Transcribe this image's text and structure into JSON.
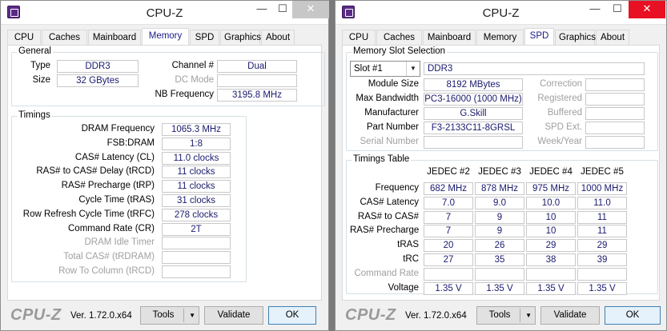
{
  "left": {
    "title": "CPU-Z",
    "controls": {
      "min": "—",
      "max": "☐",
      "close": "✕"
    },
    "tabs": [
      "CPU",
      "Caches",
      "Mainboard",
      "Memory",
      "SPD",
      "Graphics",
      "About"
    ],
    "active_tab": "Memory",
    "general": {
      "title": "General",
      "type_label": "Type",
      "type_value": "DDR3",
      "size_label": "Size",
      "size_value": "32 GBytes",
      "channel_label": "Channel #",
      "channel_value": "Dual",
      "dcmode_label": "DC Mode",
      "dcmode_value": "",
      "nbfreq_label": "NB Frequency",
      "nbfreq_value": "3195.8 MHz"
    },
    "timings": {
      "title": "Timings",
      "rows": [
        {
          "label": "DRAM Frequency",
          "value": "1065.3 MHz",
          "dim": false
        },
        {
          "label": "FSB:DRAM",
          "value": "1:8",
          "dim": false
        },
        {
          "label": "CAS# Latency (CL)",
          "value": "11.0 clocks",
          "dim": false
        },
        {
          "label": "RAS# to CAS# Delay (tRCD)",
          "value": "11 clocks",
          "dim": false
        },
        {
          "label": "RAS# Precharge (tRP)",
          "value": "11 clocks",
          "dim": false
        },
        {
          "label": "Cycle Time (tRAS)",
          "value": "31 clocks",
          "dim": false
        },
        {
          "label": "Row Refresh Cycle Time (tRFC)",
          "value": "278 clocks",
          "dim": false
        },
        {
          "label": "Command Rate (CR)",
          "value": "2T",
          "dim": false
        },
        {
          "label": "DRAM Idle Timer",
          "value": "",
          "dim": true
        },
        {
          "label": "Total CAS# (tRDRAM)",
          "value": "",
          "dim": true
        },
        {
          "label": "Row To Column (tRCD)",
          "value": "",
          "dim": true
        }
      ]
    },
    "footer": {
      "logo": "CPU-Z",
      "version": "Ver. 1.72.0.x64",
      "tools": "Tools",
      "validate": "Validate",
      "ok": "OK"
    }
  },
  "right": {
    "title": "CPU-Z",
    "controls": {
      "min": "—",
      "max": "☐",
      "close": "✕"
    },
    "tabs": [
      "CPU",
      "Caches",
      "Mainboard",
      "Memory",
      "SPD",
      "Graphics",
      "About"
    ],
    "active_tab": "SPD",
    "slot": {
      "title": "Memory Slot Selection",
      "selected": "Slot #1",
      "type_value": "DDR3",
      "module_size_label": "Module Size",
      "module_size_value": "8192 MBytes",
      "max_bw_label": "Max Bandwidth",
      "max_bw_value": "PC3-16000 (1000 MHz)",
      "manufacturer_label": "Manufacturer",
      "manufacturer_value": "G.Skill",
      "part_label": "Part Number",
      "part_value": "F3-2133C11-8GRSL",
      "serial_label": "Serial Number",
      "serial_value": "",
      "correction_label": "Correction",
      "correction_value": "",
      "registered_label": "Registered",
      "registered_value": "",
      "buffered_label": "Buffered",
      "buffered_value": "",
      "spdext_label": "SPD Ext.",
      "spdext_value": "",
      "weekyear_label": "Week/Year",
      "weekyear_value": ""
    },
    "timings_table": {
      "title": "Timings Table",
      "headers": [
        "JEDEC #2",
        "JEDEC #3",
        "JEDEC #4",
        "JEDEC #5"
      ],
      "rows": [
        {
          "label": "Frequency",
          "values": [
            "682 MHz",
            "878 MHz",
            "975 MHz",
            "1000 MHz"
          ],
          "dim": false
        },
        {
          "label": "CAS# Latency",
          "values": [
            "7.0",
            "9.0",
            "10.0",
            "11.0"
          ],
          "dim": false
        },
        {
          "label": "RAS# to CAS#",
          "values": [
            "7",
            "9",
            "10",
            "11"
          ],
          "dim": false
        },
        {
          "label": "RAS# Precharge",
          "values": [
            "7",
            "9",
            "10",
            "11"
          ],
          "dim": false
        },
        {
          "label": "tRAS",
          "values": [
            "20",
            "26",
            "29",
            "29"
          ],
          "dim": false
        },
        {
          "label": "tRC",
          "values": [
            "27",
            "35",
            "38",
            "39"
          ],
          "dim": false
        },
        {
          "label": "Command Rate",
          "values": [
            "",
            "",
            "",
            ""
          ],
          "dim": true
        },
        {
          "label": "Voltage",
          "values": [
            "1.35 V",
            "1.35 V",
            "1.35 V",
            "1.35 V"
          ],
          "dim": false
        }
      ]
    },
    "footer": {
      "logo": "CPU-Z",
      "version": "Ver. 1.72.0.x64",
      "tools": "Tools",
      "validate": "Validate",
      "ok": "OK"
    }
  }
}
